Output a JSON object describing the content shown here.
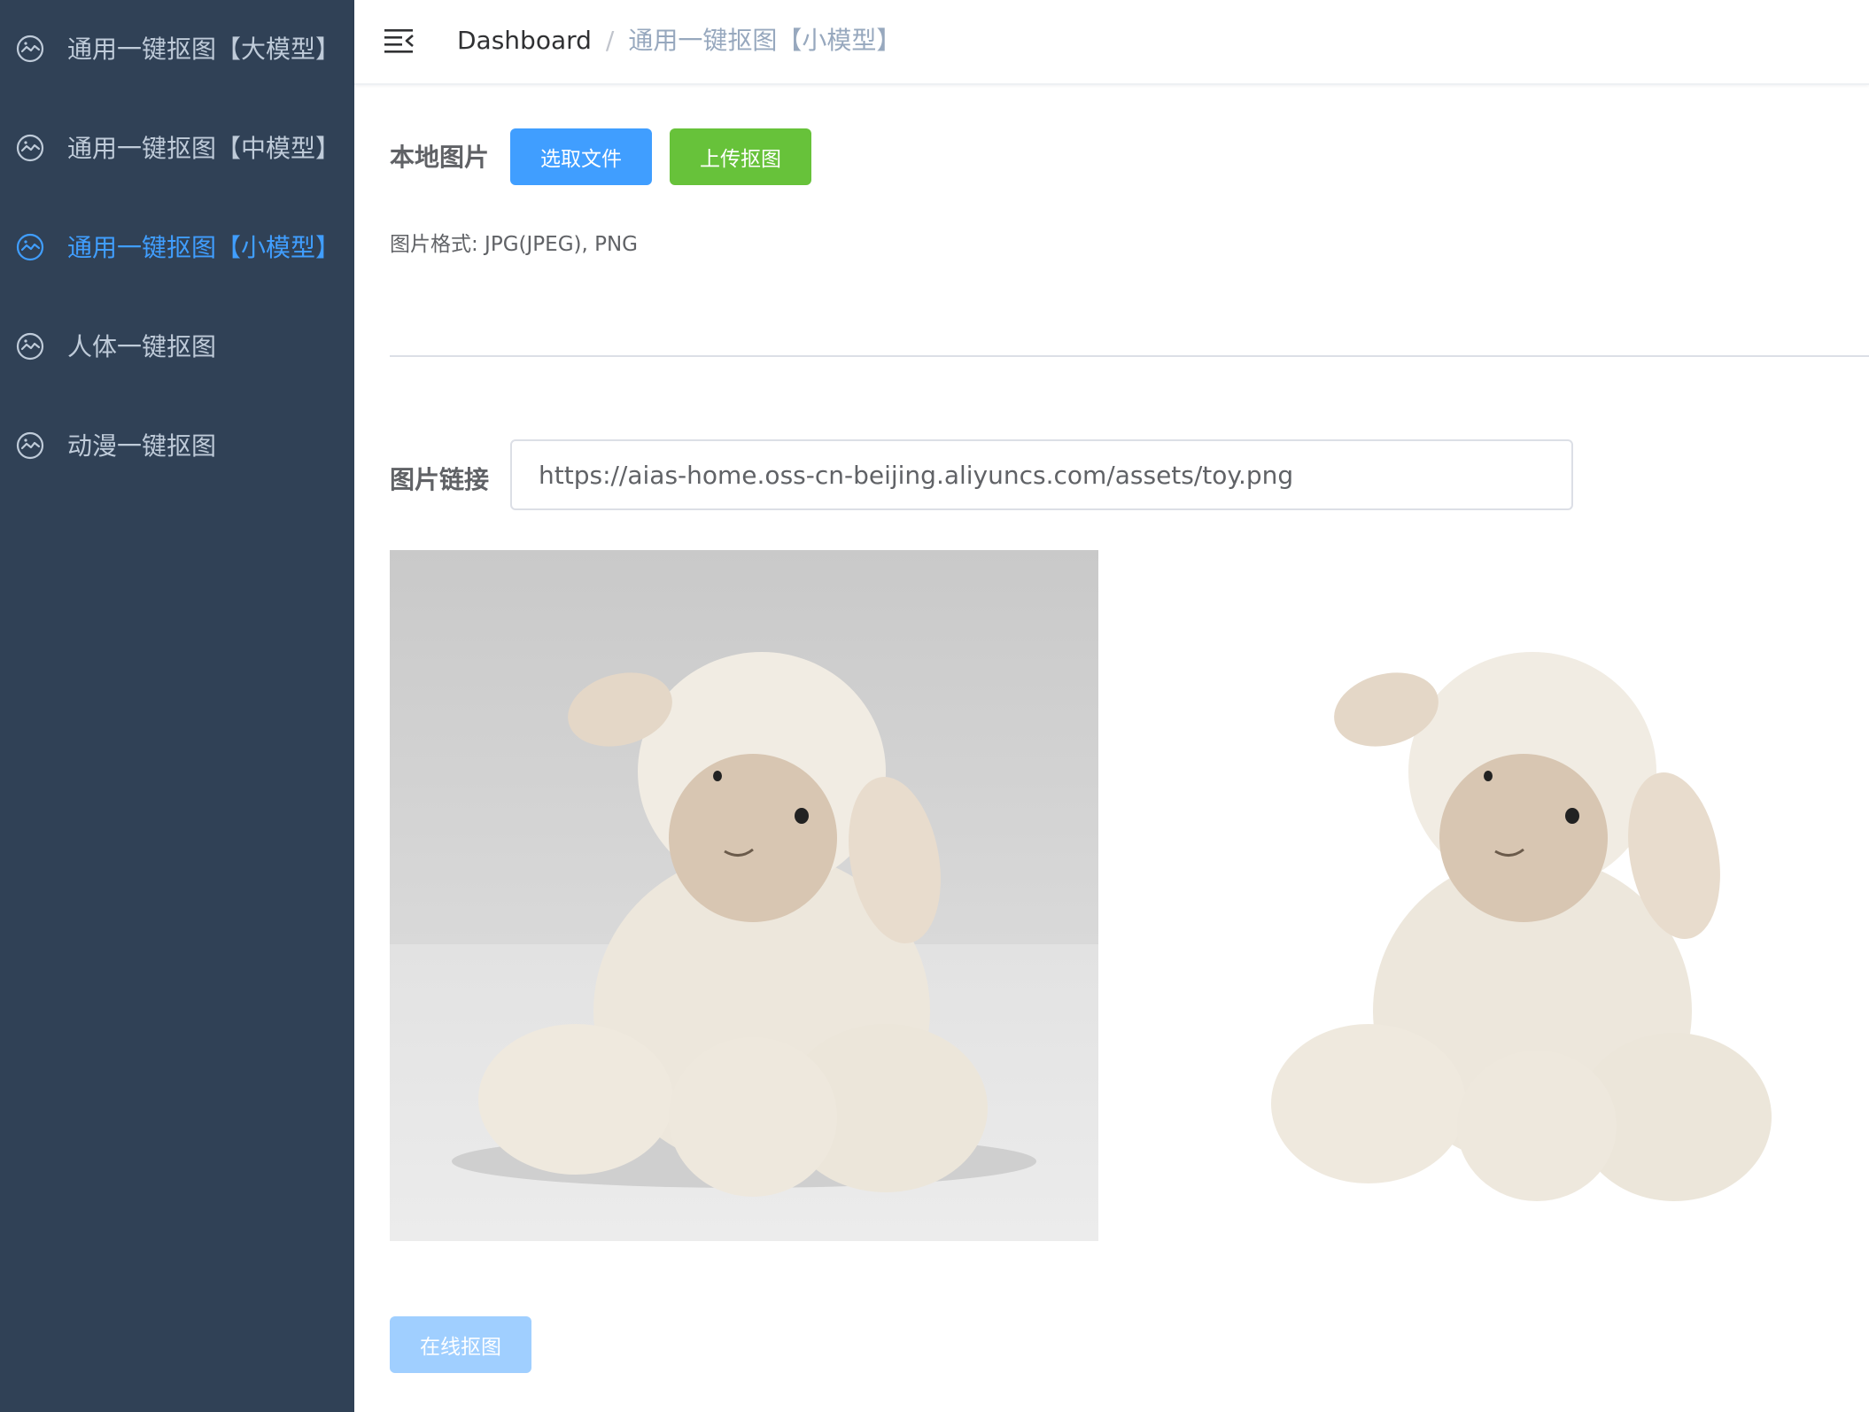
{
  "sidebar": {
    "items": [
      {
        "label": "通用一键抠图【大模型】",
        "icon": "image-icon",
        "active": false
      },
      {
        "label": "通用一键抠图【中模型】",
        "icon": "image-icon",
        "active": false
      },
      {
        "label": "通用一键抠图【小模型】",
        "icon": "image-icon",
        "active": true
      },
      {
        "label": "人体一键抠图",
        "icon": "image-icon",
        "active": false
      },
      {
        "label": "动漫一键抠图",
        "icon": "image-icon",
        "active": false
      }
    ]
  },
  "navbar": {
    "breadcrumb": {
      "home": "Dashboard",
      "separator": "/",
      "current": "通用一键抠图【小模型】"
    }
  },
  "local_image": {
    "label": "本地图片",
    "choose_button": "选取文件",
    "upload_button": "上传抠图",
    "format_hint": "图片格式: JPG(JPEG), PNG"
  },
  "image_url": {
    "label": "图片链接",
    "value": "https://aias-home.oss-cn-beijing.aliyuncs.com/assets/toy.png"
  },
  "preview": {
    "original": "plush lamb toy photo",
    "result": "plush lamb toy with background removed"
  },
  "action": {
    "button": "在线抠图"
  },
  "colors": {
    "sidebar_bg": "#304156",
    "sidebar_text": "#bfcbd9",
    "active": "#409eff",
    "success": "#67c23a"
  }
}
